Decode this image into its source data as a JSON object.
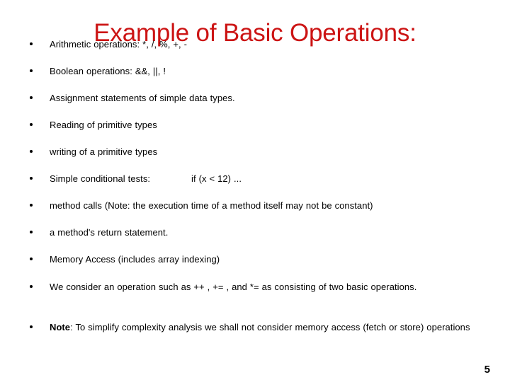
{
  "slide": {
    "title": "Example of Basic Operations:",
    "title_color": "#cc1414",
    "background_color": "#ffffff",
    "text_color": "#000000",
    "page_number": "5",
    "bullets": [
      {
        "id": "arithmetic-operations",
        "text": "Arithmetic operations: *, /, %, +, -"
      },
      {
        "id": "boolean-operations",
        "text": "Boolean operations: &&, ||, !"
      },
      {
        "id": "assignment-statements",
        "text": "Assignment statements of simple data types."
      },
      {
        "id": "reading-primitive-types",
        "text": "Reading of primitive types"
      },
      {
        "id": "writing-primitive-types",
        "text": "writing of a primitive types"
      },
      {
        "id": "simple-conditional-tests",
        "label": "Simple conditional tests:",
        "example": "if (x < 12) ..."
      },
      {
        "id": "method-calls",
        "text": "method calls (Note: the execution time of a method itself may not be constant)"
      },
      {
        "id": "method-return-statement",
        "text": "a method's return statement."
      },
      {
        "id": "memory-access",
        "text": "Memory Access  (includes array indexing)"
      },
      {
        "id": "compound-operators",
        "text": "We consider an operation such as ++ , += , and *= as consisting of two basic operations."
      },
      {
        "id": "note-memory-access",
        "lead": "Note",
        "rest": ": To simplify complexity analysis we shall not consider memory access (fetch or store) operations"
      }
    ]
  }
}
